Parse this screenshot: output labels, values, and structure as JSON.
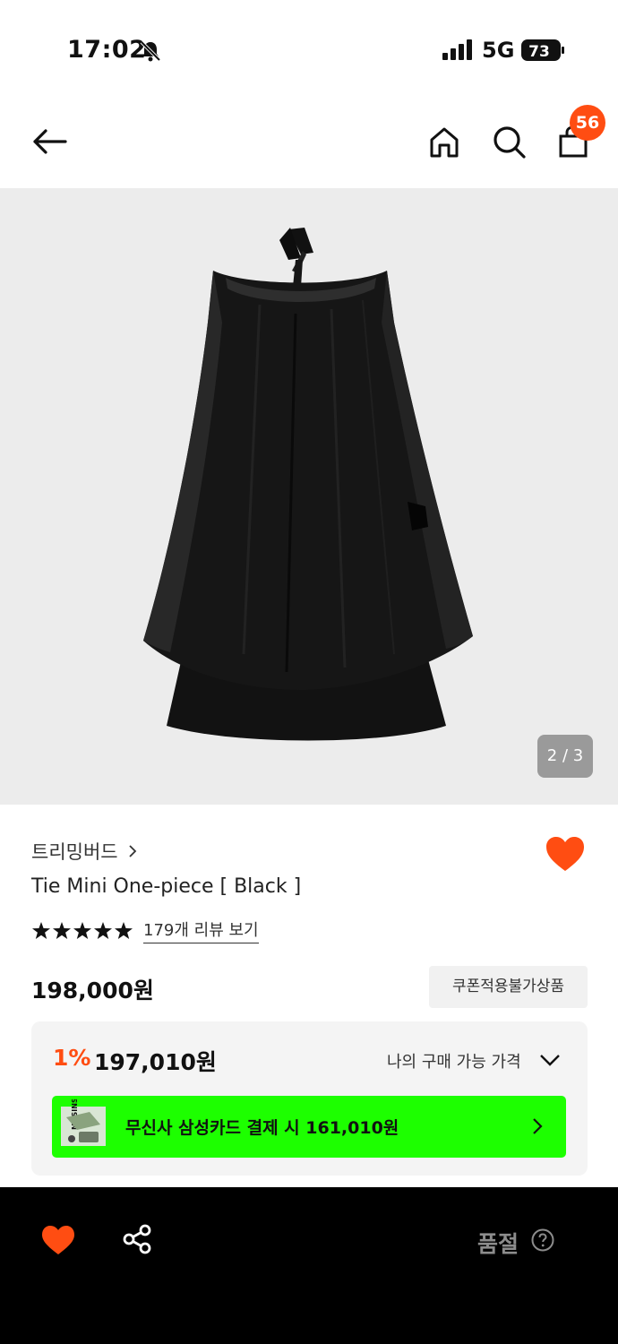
{
  "status_bar": {
    "time": "17:02",
    "network": "5G",
    "battery": "73"
  },
  "header": {
    "cart_count": "56"
  },
  "gallery": {
    "pager": "2 / 3"
  },
  "product": {
    "brand": "트리밍버드",
    "title": "Tie Mini One-piece [ Black ]",
    "stars": 5,
    "review_link": "179개 리뷰 보기",
    "price": "198,000원",
    "coupon_tag": "쿠폰적용불가상품"
  },
  "price_box": {
    "discount_rate": "1%",
    "discount_price": "197,010원",
    "my_price_label": "나의 구매 가능 가격",
    "card_banner_text": "무신사 삼성카드 결제 시 161,010원",
    "card_brand": "MUSINSA"
  },
  "bottom_bar": {
    "status": "품절"
  },
  "colors": {
    "accent": "#ff4d12",
    "banner_green": "#1dff00",
    "bottom_bg": "#000000"
  }
}
